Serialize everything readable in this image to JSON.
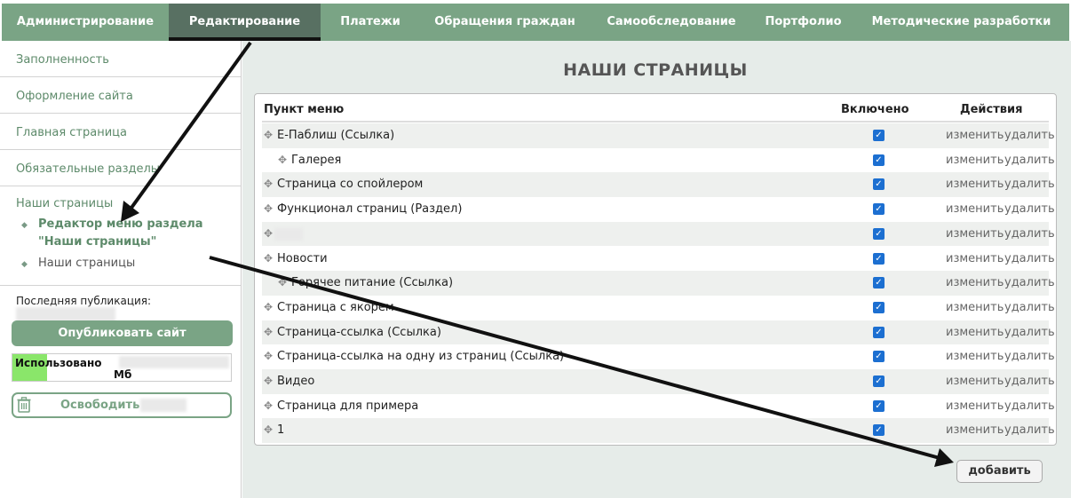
{
  "nav": {
    "items": [
      {
        "label": "Администрирование",
        "active": false
      },
      {
        "label": "Редактирование",
        "active": true
      },
      {
        "label": "Платежи",
        "active": false
      },
      {
        "label": "Обращения граждан",
        "active": false
      },
      {
        "label": "Самообследование",
        "active": false
      },
      {
        "label": "Портфолио",
        "active": false
      },
      {
        "label": "Методические разработки",
        "active": false
      }
    ]
  },
  "sidebar": {
    "links": [
      "Заполненность",
      "Оформление сайта",
      "Главная страница",
      "Обязательные разделы"
    ],
    "group_title": "Наши страницы",
    "sub_items": [
      "Редактор меню раздела \"Наши страницы\"",
      "Наши страницы"
    ],
    "last_publication_label": "Последняя публикация:",
    "publish_label": "Опубликовать сайт",
    "usage_label": "Использовано",
    "usage_unit": "Мб",
    "free_label": "Освободить"
  },
  "main": {
    "title": "НАШИ СТРАНИЦЫ",
    "columns": {
      "menu_item": "Пункт меню",
      "enabled": "Включено",
      "actions": "Действия"
    },
    "edit_label": "изменить",
    "delete_label": "удалить",
    "rows": [
      {
        "label": "Е-Паблиш (Ссылка)",
        "indent": 0,
        "enabled": true
      },
      {
        "label": "Галерея",
        "indent": 1,
        "enabled": true
      },
      {
        "label": "Страница со спойлером",
        "indent": 0,
        "enabled": true
      },
      {
        "label": "Функционал страниц (Раздел)",
        "indent": 0,
        "enabled": true
      },
      {
        "label": "",
        "indent": 0,
        "enabled": true
      },
      {
        "label": "Новости",
        "indent": 0,
        "enabled": true
      },
      {
        "label": "Горячее питание (Ссылка)",
        "indent": 1,
        "enabled": true
      },
      {
        "label": "Страница с якорем",
        "indent": 0,
        "enabled": true
      },
      {
        "label": "Страница-ссылка (Ссылка)",
        "indent": 0,
        "enabled": true
      },
      {
        "label": "Страница-ссылка на одну из страниц (Ссылка)",
        "indent": 0,
        "enabled": true
      },
      {
        "label": "Видео",
        "indent": 0,
        "enabled": true
      },
      {
        "label": "Страница для примера",
        "indent": 0,
        "enabled": true
      },
      {
        "label": "1",
        "indent": 0,
        "enabled": true
      }
    ],
    "add_label": "добавить"
  },
  "colors": {
    "accent": "#7aa485",
    "nav_active": "#587062",
    "link": "#5d8a6a",
    "checkbox": "#1c6fd1"
  }
}
